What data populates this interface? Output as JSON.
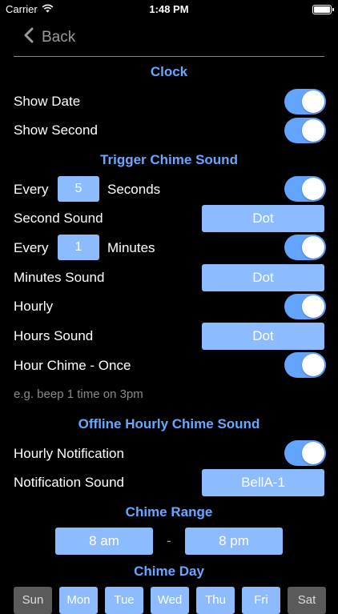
{
  "status": {
    "carrier": "Carrier",
    "time": "1:48 PM"
  },
  "nav": {
    "back_label": "Back"
  },
  "clock": {
    "title": "Clock",
    "show_date_label": "Show Date",
    "show_date_on": true,
    "show_second_label": "Show Second",
    "show_second_on": true
  },
  "trigger": {
    "title": "Trigger Chime Sound",
    "every_label": "Every",
    "seconds_value": "5",
    "seconds_label": "Seconds",
    "seconds_on": true,
    "second_sound_label": "Second Sound",
    "second_sound_value": "Dot",
    "minutes_value": "1",
    "minutes_label": "Minutes",
    "minutes_on": true,
    "minutes_sound_label": "Minutes Sound",
    "minutes_sound_value": "Dot",
    "hourly_label": "Hourly",
    "hourly_on": true,
    "hours_sound_label": "Hours Sound",
    "hours_sound_value": "Dot",
    "hour_chime_label": "Hour Chime - Once",
    "hour_chime_on": true,
    "note": "e.g. beep 1 time on 3pm"
  },
  "offline": {
    "title": "Offline Hourly Chime Sound",
    "notification_label": "Hourly Notification",
    "notification_on": true,
    "notification_sound_label": "Notification Sound",
    "notification_sound_value": "BellA-1"
  },
  "range": {
    "title": "Chime Range",
    "start": "8 am",
    "separator": "-",
    "end": "8 pm"
  },
  "days": {
    "title": "Chime Day",
    "items": [
      {
        "label": "Sun",
        "on": false
      },
      {
        "label": "Mon",
        "on": true
      },
      {
        "label": "Tue",
        "on": true
      },
      {
        "label": "Wed",
        "on": true
      },
      {
        "label": "Thu",
        "on": true
      },
      {
        "label": "Fri",
        "on": true
      },
      {
        "label": "Sat",
        "on": false
      }
    ]
  },
  "colors": {
    "accent": "#6aa7ff",
    "button": "#8dbbff",
    "toggle_on": "#63a4ff",
    "day_off": "#5a5a5a"
  }
}
